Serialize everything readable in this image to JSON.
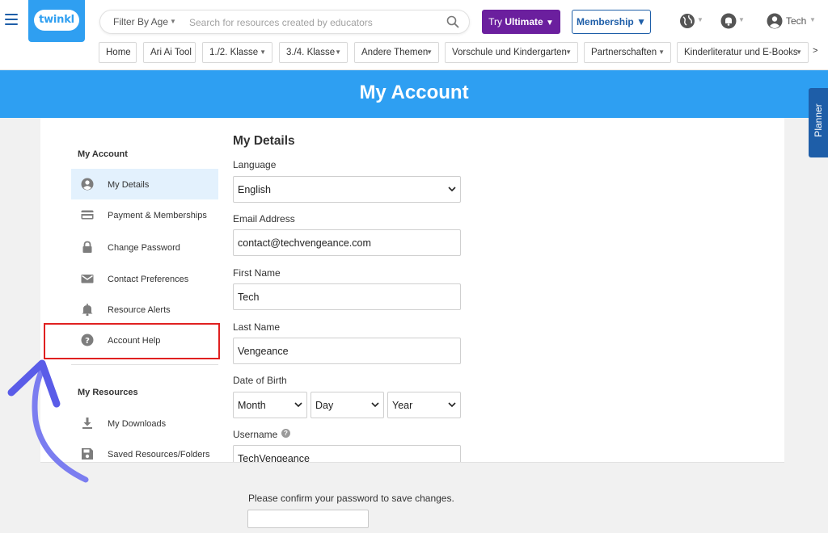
{
  "brand": {
    "logo_text": "twinkl",
    "logo_color": "#2f9ff1"
  },
  "header": {
    "filter_label": "Filter By Age",
    "search_placeholder": "Search for resources created by educators",
    "ultimate_prefix": "Try ",
    "ultimate_bold": "Ultimate",
    "ultimate_caret": "▼",
    "membership_label": "Membership ▼",
    "user_name": "Tech"
  },
  "nav": {
    "items": [
      {
        "label": "Home",
        "caret": ""
      },
      {
        "label": "Ari Ai Tool",
        "caret": ""
      },
      {
        "label": "1./2. Klasse",
        "caret": "▼"
      },
      {
        "label": "3./4. Klasse",
        "caret": "▼"
      },
      {
        "label": "Andere Themen",
        "caret": "▼"
      },
      {
        "label": "Vorschule und Kindergarten",
        "caret": "▼"
      },
      {
        "label": "Partnerschaften",
        "caret": "▼"
      },
      {
        "label": "Kinderliteratur und E-Books",
        "caret": "▼"
      }
    ],
    "next_label": ">"
  },
  "banner": {
    "title": "My Account",
    "color": "#2e9ff2"
  },
  "planner": {
    "label": "Planner"
  },
  "sidebar": {
    "account_heading": "My Account",
    "account_items": [
      {
        "label": "My Details",
        "icon": "user-circle-icon",
        "active": true
      },
      {
        "label": "Payment & Memberships",
        "icon": "credit-card-icon",
        "active": false
      },
      {
        "label": "Change Password",
        "icon": "lock-icon",
        "active": false
      },
      {
        "label": "Contact Preferences",
        "icon": "envelope-icon",
        "active": false
      },
      {
        "label": "Resource Alerts",
        "icon": "bell-icon",
        "active": false
      },
      {
        "label": "Account Help",
        "icon": "help-circle-icon",
        "active": false,
        "highlighted": true
      }
    ],
    "resources_heading": "My Resources",
    "resources_items": [
      {
        "label": "My Downloads",
        "icon": "download-icon"
      },
      {
        "label": "Saved Resources/Folders",
        "icon": "floppy-disk-icon"
      }
    ]
  },
  "form": {
    "title": "My Details",
    "language_label": "Language",
    "language_value": "English",
    "email_label": "Email Address",
    "email_value": "contact@techvengeance.com",
    "first_name_label": "First Name",
    "first_name_value": "Tech",
    "last_name_label": "Last Name",
    "last_name_value": "Vengeance",
    "dob_label": "Date of Birth",
    "dob_month": "Month",
    "dob_day": "Day",
    "dob_year": "Year",
    "username_label": "Username",
    "username_value": "TechVengeance",
    "confirm_text": "Please confirm your password to save changes."
  },
  "colors": {
    "accent_blue": "#2e9ff2",
    "nav_dark_blue": "#1e5ea8",
    "ultimate_purple": "#6b1f9e",
    "annotation_red": "#e02020",
    "annotation_arrow": "#7b7df0"
  }
}
